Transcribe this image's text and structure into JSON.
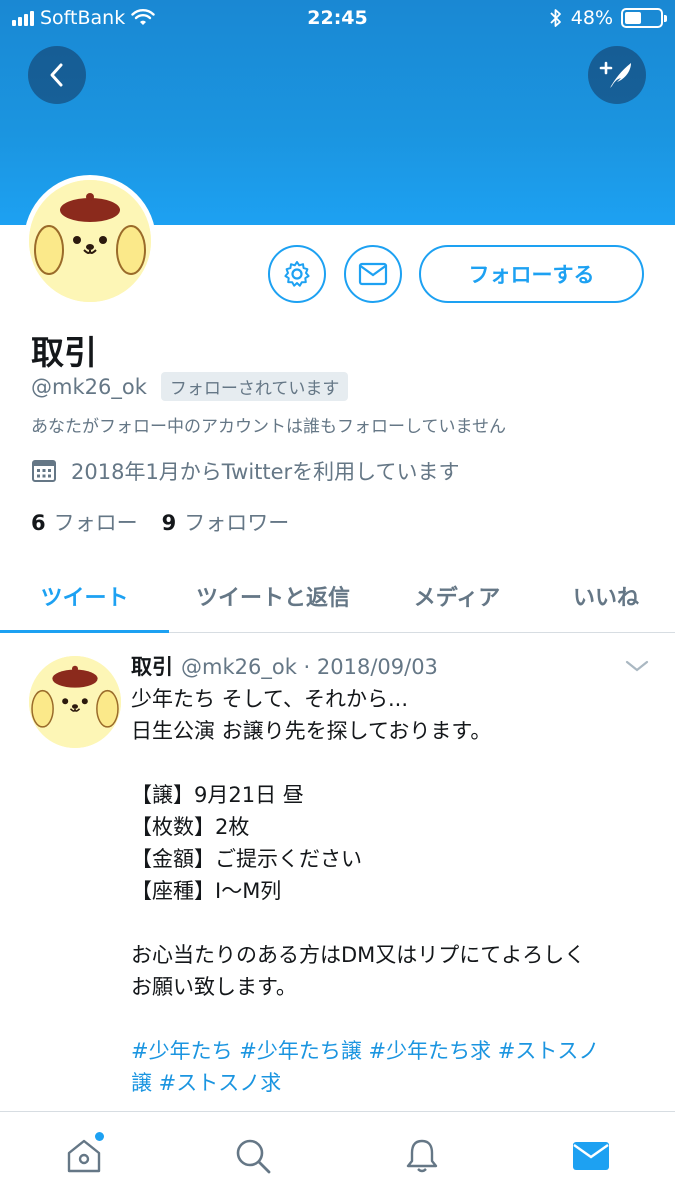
{
  "status_bar": {
    "carrier": "SoftBank",
    "time": "22:45",
    "battery_percent": "48%",
    "battery_level": 0.48
  },
  "header": {
    "back_icon": "chevron-left-icon",
    "compose_icon": "compose-tweet-icon"
  },
  "profile": {
    "display_name": "取引",
    "handle": "@mk26_ok",
    "follows_you_badge": "フォローされています",
    "no_followers_note": "あなたがフォロー中のアカウントは誰もフォローしていません",
    "joined_text": "2018年1月からTwitterを利用しています",
    "following_count": "6",
    "following_label": "フォロー",
    "followers_count": "9",
    "followers_label": "フォロワー",
    "follow_button_label": "フォローする"
  },
  "tabs": [
    {
      "label": "ツイート",
      "active": true
    },
    {
      "label": "ツイートと返信",
      "active": false
    },
    {
      "label": "メディア",
      "active": false
    },
    {
      "label": "いいね",
      "active": false
    }
  ],
  "tweet": {
    "name": "取引",
    "meta": "@mk26_ok · 2018/09/03",
    "lines": [
      "少年たち そして、それから...",
      "日生公演 お譲り先を探しております。",
      "",
      "【譲】9月21日 昼",
      "【枚数】2枚",
      "【金額】ご提示ください",
      "【座種】I〜M列",
      "",
      "お心当たりのある方はDM又はリプにてよろしく",
      "お願い致します。",
      ""
    ],
    "hashtag_line_1": "#少年たち #少年たち譲 #少年たち求 #ストスノ",
    "hashtag_line_2": "譲 #ストスノ求"
  },
  "bottom_nav": {
    "items": [
      "home-icon",
      "search-icon",
      "notifications-icon",
      "messages-icon"
    ],
    "active": "messages-icon"
  },
  "colors": {
    "accent": "#1da1f2",
    "banner": "#1b95e0",
    "secondary_text": "#657786"
  }
}
